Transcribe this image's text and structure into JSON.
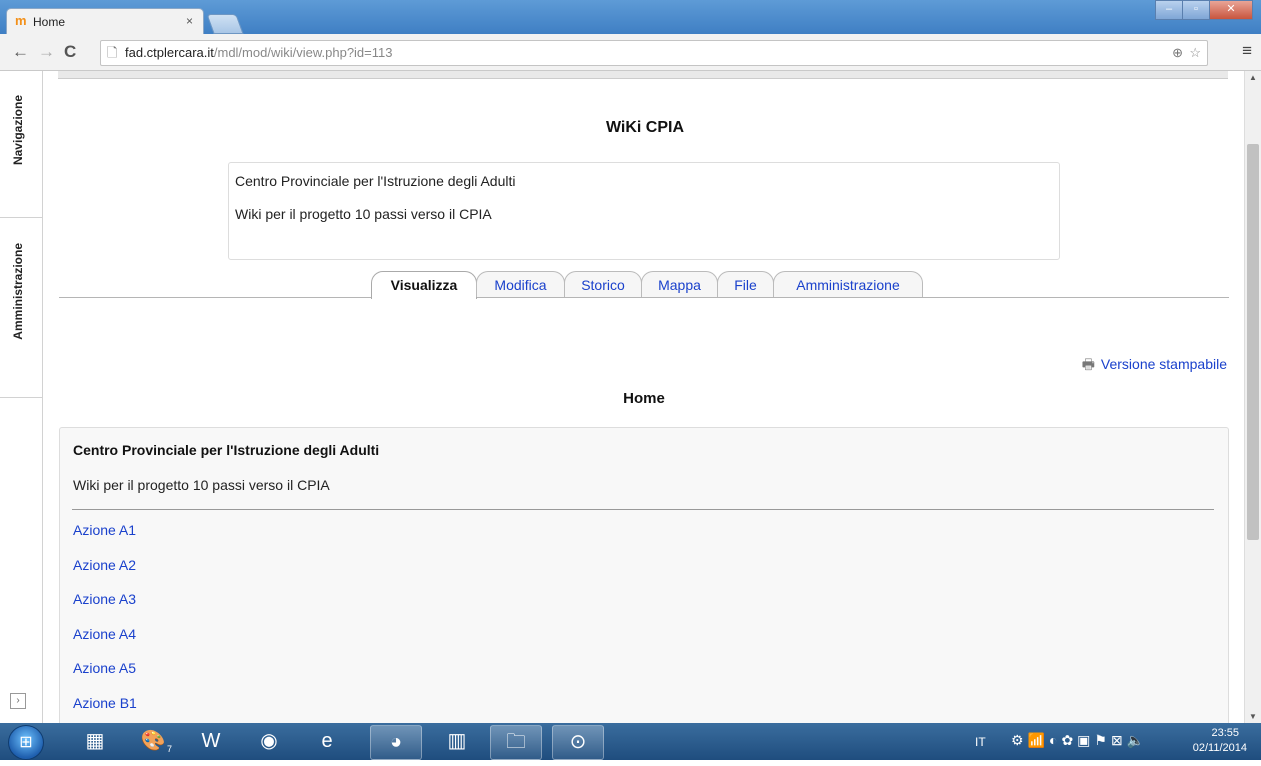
{
  "browser": {
    "tab_title": "Home",
    "tab_favicon": "m",
    "tab_close": "×",
    "url_host": "fad.ctplercara.it",
    "url_path": "/mdl/mod/wiki/view.php?id=113",
    "icons": [
      "back-icon",
      "forward-icon",
      "reload-icon",
      "page-icon",
      "zoom-icon",
      "star-icon",
      "menu-icon"
    ]
  },
  "dock": {
    "items": [
      {
        "label": "Navigazione"
      },
      {
        "label": "Amministrazione"
      }
    ]
  },
  "wiki": {
    "title": "WiKi CPIA",
    "intro_line1": "Centro Provinciale per l'Istruzione  degli Adulti",
    "intro_line2": "Wiki per il progetto 10 passi verso il CPIA",
    "tabs": [
      {
        "label": "Visualizza",
        "active": true
      },
      {
        "label": "Modifica"
      },
      {
        "label": "Storico"
      },
      {
        "label": "Mappa"
      },
      {
        "label": "File"
      },
      {
        "label": "Amministrazione"
      }
    ],
    "print_link": "Versione stampabile",
    "page_heading": "Home",
    "content": {
      "title": "Centro Provinciale per l'Istruzione degli Adulti",
      "description": "Wiki per il progetto 10 passi verso il CPIA",
      "links": [
        "Azione A1",
        "Azione A2",
        "Azione A3",
        "Azione A4",
        "Azione A5",
        "Azione B1"
      ]
    }
  },
  "taskbar": {
    "apps": [
      "calculator-icon",
      "paint-icon",
      "word-icon",
      "firefox-icon",
      "ie-icon",
      "chrome-icon",
      "archive-icon",
      "explorer-icon",
      "network-icon"
    ],
    "paint_badge": "7",
    "lang": "IT",
    "time": "23:55",
    "date": "02/11/2014"
  },
  "colors": {
    "link": "#1a41cc",
    "taskbar": "#1f4d7e",
    "titlebar": "#4a88c8"
  }
}
